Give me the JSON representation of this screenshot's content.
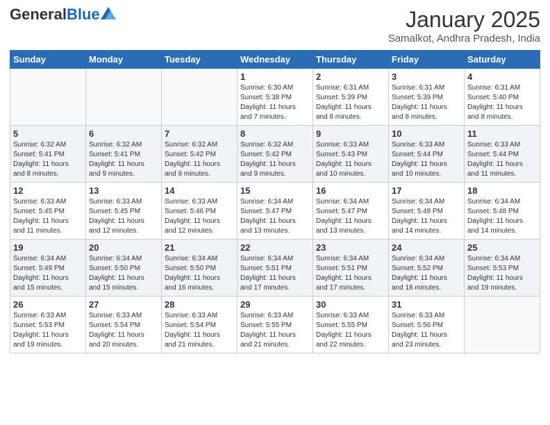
{
  "header": {
    "logo_general": "General",
    "logo_blue": "Blue",
    "month_title": "January 2025",
    "location": "Samalkot, Andhra Pradesh, India"
  },
  "weekdays": [
    "Sunday",
    "Monday",
    "Tuesday",
    "Wednesday",
    "Thursday",
    "Friday",
    "Saturday"
  ],
  "weeks": [
    [
      {
        "day": "",
        "info": ""
      },
      {
        "day": "",
        "info": ""
      },
      {
        "day": "",
        "info": ""
      },
      {
        "day": "1",
        "info": "Sunrise: 6:30 AM\nSunset: 5:38 PM\nDaylight: 11 hours\nand 7 minutes."
      },
      {
        "day": "2",
        "info": "Sunrise: 6:31 AM\nSunset: 5:39 PM\nDaylight: 11 hours\nand 8 minutes."
      },
      {
        "day": "3",
        "info": "Sunrise: 6:31 AM\nSunset: 5:39 PM\nDaylight: 11 hours\nand 8 minutes."
      },
      {
        "day": "4",
        "info": "Sunrise: 6:31 AM\nSunset: 5:40 PM\nDaylight: 11 hours\nand 8 minutes."
      }
    ],
    [
      {
        "day": "5",
        "info": "Sunrise: 6:32 AM\nSunset: 5:41 PM\nDaylight: 11 hours\nand 8 minutes."
      },
      {
        "day": "6",
        "info": "Sunrise: 6:32 AM\nSunset: 5:41 PM\nDaylight: 11 hours\nand 9 minutes."
      },
      {
        "day": "7",
        "info": "Sunrise: 6:32 AM\nSunset: 5:42 PM\nDaylight: 11 hours\nand 9 minutes."
      },
      {
        "day": "8",
        "info": "Sunrise: 6:32 AM\nSunset: 5:42 PM\nDaylight: 11 hours\nand 9 minutes."
      },
      {
        "day": "9",
        "info": "Sunrise: 6:33 AM\nSunset: 5:43 PM\nDaylight: 11 hours\nand 10 minutes."
      },
      {
        "day": "10",
        "info": "Sunrise: 6:33 AM\nSunset: 5:44 PM\nDaylight: 11 hours\nand 10 minutes."
      },
      {
        "day": "11",
        "info": "Sunrise: 6:33 AM\nSunset: 5:44 PM\nDaylight: 11 hours\nand 11 minutes."
      }
    ],
    [
      {
        "day": "12",
        "info": "Sunrise: 6:33 AM\nSunset: 5:45 PM\nDaylight: 11 hours\nand 11 minutes."
      },
      {
        "day": "13",
        "info": "Sunrise: 6:33 AM\nSunset: 5:45 PM\nDaylight: 11 hours\nand 12 minutes."
      },
      {
        "day": "14",
        "info": "Sunrise: 6:33 AM\nSunset: 5:46 PM\nDaylight: 11 hours\nand 12 minutes."
      },
      {
        "day": "15",
        "info": "Sunrise: 6:34 AM\nSunset: 5:47 PM\nDaylight: 11 hours\nand 13 minutes."
      },
      {
        "day": "16",
        "info": "Sunrise: 6:34 AM\nSunset: 5:47 PM\nDaylight: 11 hours\nand 13 minutes."
      },
      {
        "day": "17",
        "info": "Sunrise: 6:34 AM\nSunset: 5:48 PM\nDaylight: 11 hours\nand 14 minutes."
      },
      {
        "day": "18",
        "info": "Sunrise: 6:34 AM\nSunset: 5:48 PM\nDaylight: 11 hours\nand 14 minutes."
      }
    ],
    [
      {
        "day": "19",
        "info": "Sunrise: 6:34 AM\nSunset: 5:49 PM\nDaylight: 11 hours\nand 15 minutes."
      },
      {
        "day": "20",
        "info": "Sunrise: 6:34 AM\nSunset: 5:50 PM\nDaylight: 11 hours\nand 15 minutes."
      },
      {
        "day": "21",
        "info": "Sunrise: 6:34 AM\nSunset: 5:50 PM\nDaylight: 11 hours\nand 16 minutes."
      },
      {
        "day": "22",
        "info": "Sunrise: 6:34 AM\nSunset: 5:51 PM\nDaylight: 11 hours\nand 17 minutes."
      },
      {
        "day": "23",
        "info": "Sunrise: 6:34 AM\nSunset: 5:51 PM\nDaylight: 11 hours\nand 17 minutes."
      },
      {
        "day": "24",
        "info": "Sunrise: 6:34 AM\nSunset: 5:52 PM\nDaylight: 11 hours\nand 18 minutes."
      },
      {
        "day": "25",
        "info": "Sunrise: 6:34 AM\nSunset: 5:53 PM\nDaylight: 11 hours\nand 19 minutes."
      }
    ],
    [
      {
        "day": "26",
        "info": "Sunrise: 6:33 AM\nSunset: 5:53 PM\nDaylight: 11 hours\nand 19 minutes."
      },
      {
        "day": "27",
        "info": "Sunrise: 6:33 AM\nSunset: 5:54 PM\nDaylight: 11 hours\nand 20 minutes."
      },
      {
        "day": "28",
        "info": "Sunrise: 6:33 AM\nSunset: 5:54 PM\nDaylight: 11 hours\nand 21 minutes."
      },
      {
        "day": "29",
        "info": "Sunrise: 6:33 AM\nSunset: 5:55 PM\nDaylight: 11 hours\nand 21 minutes."
      },
      {
        "day": "30",
        "info": "Sunrise: 6:33 AM\nSunset: 5:55 PM\nDaylight: 11 hours\nand 22 minutes."
      },
      {
        "day": "31",
        "info": "Sunrise: 6:33 AM\nSunset: 5:56 PM\nDaylight: 11 hours\nand 23 minutes."
      },
      {
        "day": "",
        "info": ""
      }
    ]
  ]
}
